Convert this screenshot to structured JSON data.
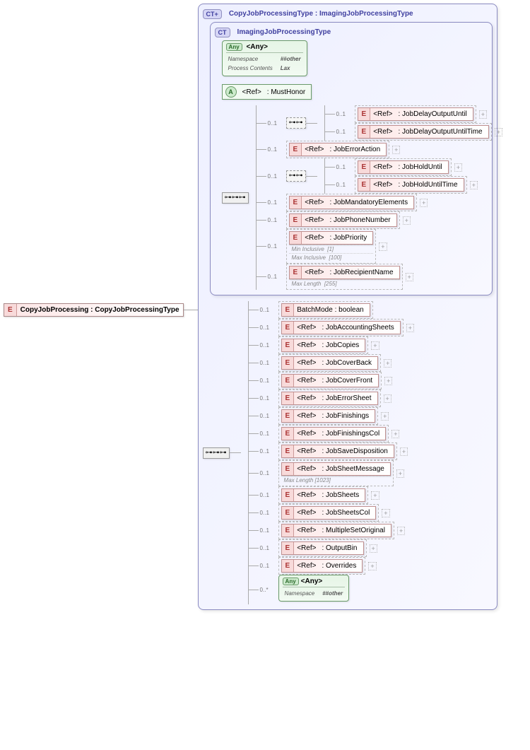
{
  "root": {
    "badge": "E",
    "name": "CopyJobProcessing : CopyJobProcessingType"
  },
  "outer_ct": {
    "badge": "CT+",
    "title": "CopyJobProcessingType : ImagingJobProcessingType"
  },
  "inner_ct": {
    "badge": "CT",
    "title": "ImagingJobProcessingType"
  },
  "any_top": {
    "badge": "Any",
    "label": "<Any>",
    "attrs": [
      [
        "Namespace",
        "##other"
      ],
      [
        "Process Contents",
        "Lax"
      ]
    ]
  },
  "attr_ref": {
    "badge": "A",
    "ref": "<Ref>",
    "name": ": MustHonor"
  },
  "mh_children": {
    "group1_occ": "0..1",
    "group1": [
      {
        "occ": "0..1",
        "ref": "<Ref>",
        "name": ": JobDelayOutputUntil",
        "plus": true
      },
      {
        "occ": "0..1",
        "ref": "<Ref>",
        "name": ": JobDelayOutputUntilTime",
        "plus": true
      }
    ],
    "row_err": {
      "occ": "0..1",
      "ref": "<Ref>",
      "name": ": JobErrorAction",
      "plus": true
    },
    "group2_occ": "0..1",
    "group2": [
      {
        "occ": "0..1",
        "ref": "<Ref>",
        "name": ": JobHoldUntil",
        "plus": true
      },
      {
        "occ": "0..1",
        "ref": "<Ref>",
        "name": ": JobHoldUntilTime",
        "plus": true
      }
    ],
    "row_mand": {
      "occ": "0..1",
      "ref": "<Ref>",
      "name": ": JobMandatoryElements",
      "plus": true
    },
    "row_phone": {
      "occ": "0..1",
      "ref": "<Ref>",
      "name": ": JobPhoneNumber",
      "plus": true
    },
    "row_prio": {
      "occ": "0..1",
      "ref": "<Ref>",
      "name": ": JobPriority",
      "plus": true,
      "facets": [
        [
          "Min Inclusive",
          "[1]"
        ],
        [
          "Max Inclusive",
          "[100]"
        ]
      ]
    },
    "row_recip": {
      "occ": "0..1",
      "ref": "<Ref>",
      "name": ": JobRecipientName",
      "plus": true,
      "facets": [
        [
          "Max Length",
          "[255]"
        ]
      ]
    }
  },
  "outer_children": [
    {
      "occ": "0..1",
      "badge": "E",
      "label": "BatchMode : boolean"
    },
    {
      "occ": "0..1",
      "badge": "E",
      "ref": "<Ref>",
      "name": ": JobAccountingSheets",
      "plus": true
    },
    {
      "occ": "0..1",
      "badge": "E",
      "ref": "<Ref>",
      "name": ": JobCopies",
      "plus": true
    },
    {
      "occ": "0..1",
      "badge": "E",
      "ref": "<Ref>",
      "name": ": JobCoverBack",
      "plus": true
    },
    {
      "occ": "0..1",
      "badge": "E",
      "ref": "<Ref>",
      "name": ": JobCoverFront",
      "plus": true
    },
    {
      "occ": "0..1",
      "badge": "E",
      "ref": "<Ref>",
      "name": ": JobErrorSheet",
      "plus": true
    },
    {
      "occ": "0..1",
      "badge": "E",
      "ref": "<Ref>",
      "name": ": JobFinishings",
      "plus": true
    },
    {
      "occ": "0..1",
      "badge": "E",
      "ref": "<Ref>",
      "name": ": JobFinishingsCol",
      "plus": true
    },
    {
      "occ": "0..1",
      "badge": "E",
      "ref": "<Ref>",
      "name": ": JobSaveDisposition",
      "plus": true
    },
    {
      "occ": "0..1",
      "badge": "E",
      "ref": "<Ref>",
      "name": ": JobSheetMessage",
      "plus": true,
      "facets": [
        [
          "Max Length",
          "[1023]"
        ]
      ]
    },
    {
      "occ": "0..1",
      "badge": "E",
      "ref": "<Ref>",
      "name": ": JobSheets",
      "plus": true
    },
    {
      "occ": "0..1",
      "badge": "E",
      "ref": "<Ref>",
      "name": ": JobSheetsCol",
      "plus": true
    },
    {
      "occ": "0..1",
      "badge": "E",
      "ref": "<Ref>",
      "name": ": MultipleSetOriginal",
      "plus": true
    },
    {
      "occ": "0..1",
      "badge": "E",
      "ref": "<Ref>",
      "name": ": OutputBin",
      "plus": true
    },
    {
      "occ": "0..1",
      "badge": "E",
      "ref": "<Ref>",
      "name": ": Overrides",
      "plus": true
    }
  ],
  "any_bottom": {
    "occ": "0..*",
    "badge": "Any",
    "label": "<Any>",
    "attrs": [
      [
        "Namespace",
        "##other"
      ]
    ]
  }
}
